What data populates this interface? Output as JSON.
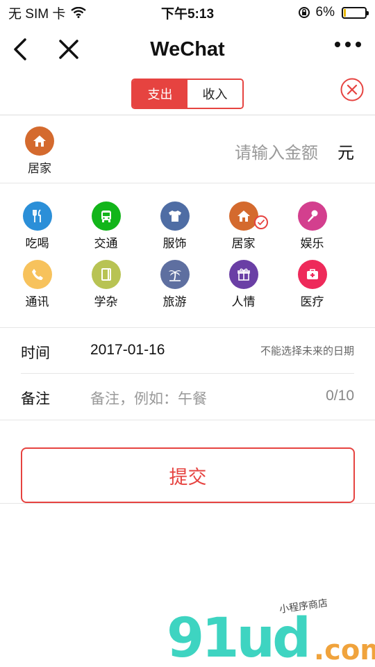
{
  "status_bar": {
    "carrier": "无 SIM 卡",
    "time": "下午5:13",
    "battery": "6%"
  },
  "nav": {
    "title": "WeChat"
  },
  "segment": {
    "expense": "支出",
    "income": "收入"
  },
  "amount": {
    "category": "居家",
    "placeholder": "请输入金额",
    "unit": "元"
  },
  "categories": [
    {
      "label": "吃喝",
      "color": "#2b8fd8",
      "icon": "utensils-icon"
    },
    {
      "label": "交通",
      "color": "#12b51a",
      "icon": "bus-icon"
    },
    {
      "label": "服饰",
      "color": "#4f6da4",
      "icon": "shirt-icon"
    },
    {
      "label": "居家",
      "color": "#d46a2e",
      "icon": "home-icon",
      "selected": true
    },
    {
      "label": "娱乐",
      "color": "#d33f8e",
      "icon": "microphone-icon"
    },
    {
      "label": "通讯",
      "color": "#f7c25c",
      "icon": "phone-icon"
    },
    {
      "label": "学杂",
      "color": "#b8c353",
      "icon": "book-icon"
    },
    {
      "label": "旅游",
      "color": "#5e6fa0",
      "icon": "palm-tree-icon"
    },
    {
      "label": "人情",
      "color": "#6a3fa5",
      "icon": "gift-icon"
    },
    {
      "label": "医疗",
      "color": "#ee2a5a",
      "icon": "medical-kit-icon"
    }
  ],
  "form": {
    "time_label": "时间",
    "date": "2017-01-16",
    "date_hint": "不能选择未来的日期",
    "note_label": "备注",
    "note_placeholder": "备注，例如：午餐",
    "note_count": "0/10"
  },
  "submit": {
    "label": "提交"
  },
  "watermark": {
    "big": "91ud",
    "com": ".com",
    "small": "小程序商店"
  },
  "colors": {
    "accent": "#e64340"
  }
}
